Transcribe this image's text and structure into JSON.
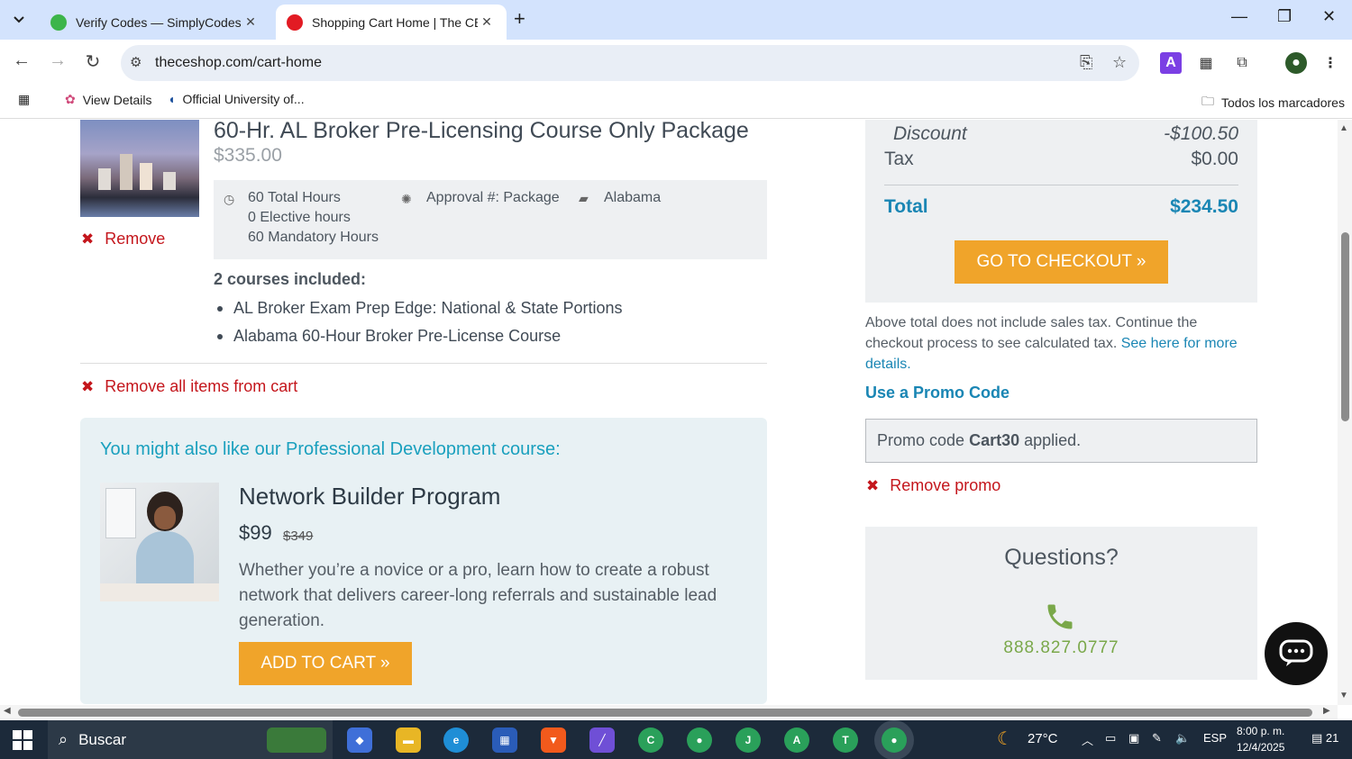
{
  "browser": {
    "tabs": [
      {
        "title": "Verify Codes — SimplyCodes",
        "favicon_color": "#3cb54a"
      },
      {
        "title": "Shopping Cart Home | The CE S",
        "favicon_color": "#e21b23"
      }
    ],
    "url": "theceshop.com/cart-home",
    "bookmarks": [
      "View Details",
      "Official University of...",
      "Todos los marcadores"
    ]
  },
  "cart_item": {
    "title": "60-Hr. AL Broker Pre-Licensing Course Only Package",
    "price": "$335.00",
    "remove_label": "Remove",
    "hours": [
      "60 Total Hours",
      "0 Elective hours",
      "60 Mandatory Hours"
    ],
    "approval": "Approval #: Package",
    "state": "Alabama",
    "courses_heading": "2 courses included:",
    "courses": [
      "AL Broker Exam Prep Edge: National & State Portions",
      "Alabama 60-Hour Broker Pre-License Course"
    ]
  },
  "remove_all_label": "Remove all items from cart",
  "promo_offer": {
    "heading": "You might also like our Professional Development course:",
    "title": "Network Builder Program",
    "price": "$99",
    "old_price": "$349",
    "description": "Whether you’re a novice or a pro, learn how to create a robust network that delivers career-long referrals and sustainable lead generation.",
    "button": "ADD TO CART »"
  },
  "summary": {
    "discount_label": "Discount",
    "discount_value": "-$100.50",
    "tax_label": "Tax",
    "tax_value": "$0.00",
    "total_label": "Total",
    "total_value": "$234.50",
    "checkout_button": "GO TO CHECKOUT »",
    "note": "Above total does not include sales tax. Continue the checkout process to see calculated tax.",
    "note_link": "See here for more details.",
    "promo_heading": "Use a Promo Code",
    "promo_prefix": "Promo code",
    "promo_code": "Cart30",
    "promo_suffix": "applied.",
    "remove_promo": "Remove promo",
    "questions": "Questions?",
    "phone": "888.827.0777"
  },
  "taskbar": {
    "search": "Buscar",
    "weather": "27°C",
    "lang": "ESP",
    "time": "8:00 p. m.",
    "date": "12/4/2025",
    "notifications": "21"
  },
  "colors": {
    "accent_red": "#c4161c",
    "accent_blue": "#1a86b4",
    "accent_orange": "#f0a42a",
    "phone_green": "#7aa84a"
  }
}
